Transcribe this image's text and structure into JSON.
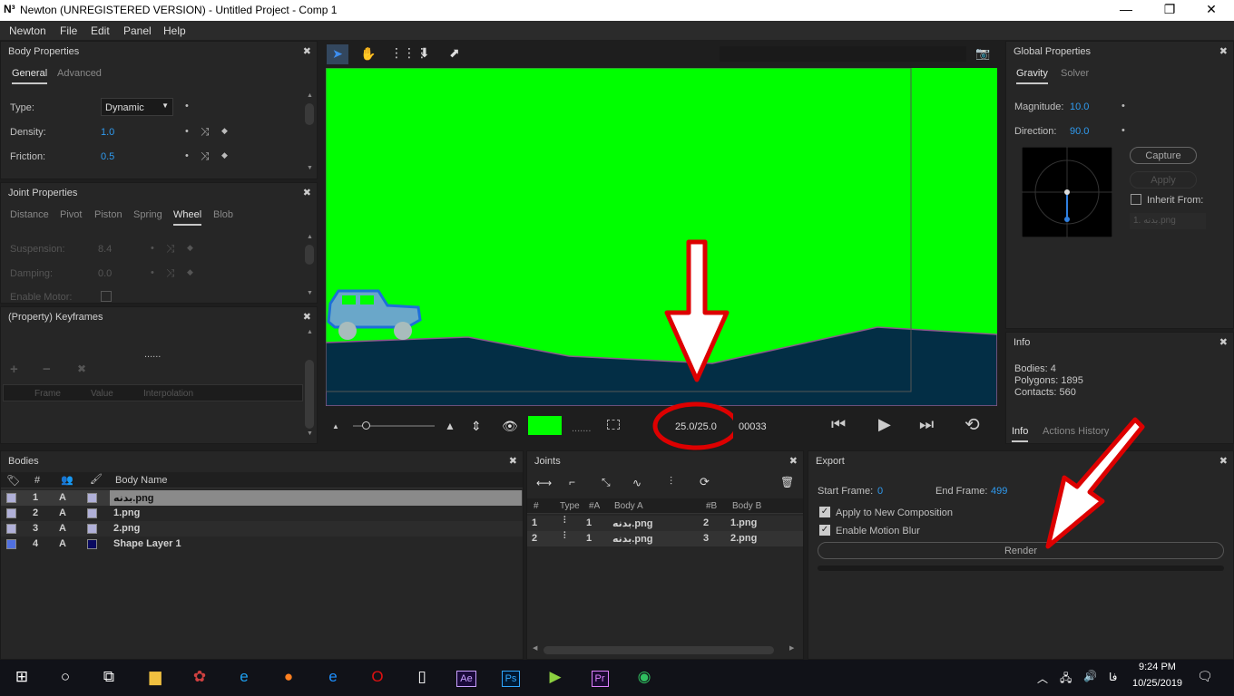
{
  "window": {
    "logo": "N³",
    "title": "Newton (UNREGISTERED VERSION) - Untitled Project - Comp 1"
  },
  "menu": [
    "Newton",
    "File",
    "Edit",
    "Panel",
    "Help"
  ],
  "body_properties": {
    "title": "Body Properties",
    "tabs": [
      "General",
      "Advanced"
    ],
    "type_label": "Type:",
    "type_value": "Dynamic",
    "density_label": "Density:",
    "density_value": "1.0",
    "friction_label": "Friction:",
    "friction_value": "0.5"
  },
  "joint_properties": {
    "title": "Joint Properties",
    "tabs": [
      "Distance",
      "Pivot",
      "Piston",
      "Spring",
      "Wheel",
      "Blob"
    ],
    "suspension_label": "Suspension:",
    "suspension_value": "8.4",
    "damping_label": "Damping:",
    "damping_value": "0.0",
    "motor_label": "Enable Motor:"
  },
  "keyframes": {
    "title": "(Property) Keyframes",
    "dots": "......",
    "cols": [
      "Frame",
      "Value",
      "Interpolation"
    ]
  },
  "viewer": {
    "frame_text": "25.0/25.0",
    "frame_num": "00033"
  },
  "global_properties": {
    "title": "Global Properties",
    "tabs": [
      "Gravity",
      "Solver"
    ],
    "magnitude_label": "Magnitude:",
    "magnitude_value": "10.0",
    "direction_label": "Direction:",
    "direction_value": "90.0",
    "capture": "Capture",
    "apply": "Apply",
    "inherit_label": "Inherit From:",
    "inherit_value": "1. بدنه.png"
  },
  "info": {
    "title": "Info",
    "bodies": "Bodies: 4",
    "polygons": "Polygons: 1895",
    "contacts": "Contacts: 560",
    "tabs": [
      "Info",
      "Actions History"
    ]
  },
  "bodies": {
    "title": "Bodies",
    "col_num": "#",
    "col_name": "Body Name",
    "rows": [
      {
        "num": "1",
        "a": "A",
        "name": "بدنه.png",
        "color": "#b0b0d8"
      },
      {
        "num": "2",
        "a": "A",
        "name": "1.png",
        "color": "#b0b0d8"
      },
      {
        "num": "3",
        "a": "A",
        "name": "2.png",
        "color": "#b0b0d8"
      },
      {
        "num": "4",
        "a": "A",
        "name": "Shape Layer 1",
        "color": "#0a0a60"
      }
    ]
  },
  "joints": {
    "title": "Joints",
    "cols": [
      "#",
      "Type",
      "#A",
      "Body A",
      "#B",
      "Body B"
    ],
    "rows": [
      {
        "num": "1",
        "a": "1",
        "body_a": "بدنه.png",
        "b": "2",
        "body_b": "1.png"
      },
      {
        "num": "2",
        "a": "1",
        "body_a": "بدنه.png",
        "b": "3",
        "body_b": "2.png"
      }
    ]
  },
  "export": {
    "title": "Export",
    "start_label": "Start Frame:",
    "start_value": "0",
    "end_label": "End Frame:",
    "end_value": "499",
    "apply_comp": "Apply to New Composition",
    "motion_blur": "Enable Motion Blur",
    "render": "Render"
  },
  "taskbar": {
    "lang": "فا",
    "time": "9:24 PM",
    "date": "10/25/2019"
  }
}
